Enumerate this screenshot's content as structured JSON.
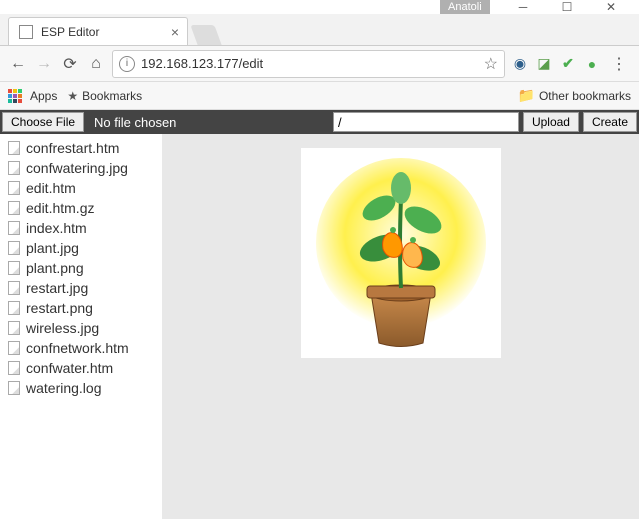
{
  "window": {
    "profile": "Anatoli"
  },
  "tab": {
    "title": "ESP Editor"
  },
  "omnibox": {
    "url": "192.168.123.177/edit"
  },
  "bookmarks": {
    "apps": "Apps",
    "bookmarks": "Bookmarks",
    "other": "Other bookmarks"
  },
  "editor": {
    "choose_file": "Choose File",
    "no_file": "No file chosen",
    "path_value": "/",
    "upload": "Upload",
    "create": "Create"
  },
  "files": [
    "confrestart.htm",
    "confwatering.jpg",
    "edit.htm",
    "edit.htm.gz",
    "index.htm",
    "plant.jpg",
    "plant.png",
    "restart.jpg",
    "restart.png",
    "wireless.jpg",
    "confnetwork.htm",
    "confwater.htm",
    "watering.log"
  ]
}
